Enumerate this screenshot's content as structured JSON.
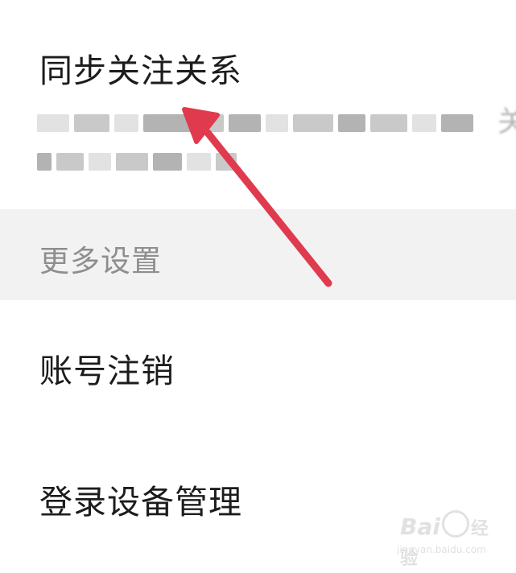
{
  "settings": {
    "sync_follow": {
      "title": "同步关注关系",
      "description_tail": "关"
    },
    "more_settings_header": "更多设置",
    "account_cancel": {
      "title": "账号注销"
    },
    "device_manage": {
      "title": "登录设备管理"
    }
  },
  "annotation": {
    "arrow_color": "#e03a4e"
  },
  "watermark": {
    "logo_text": "Bai",
    "logo_text_2": "经验",
    "url": "jingyan.baidu.com"
  },
  "colors": {
    "section_bg": "#f2f2f2",
    "title_text": "#1c1c1c",
    "header_text": "#8e8e8e"
  }
}
